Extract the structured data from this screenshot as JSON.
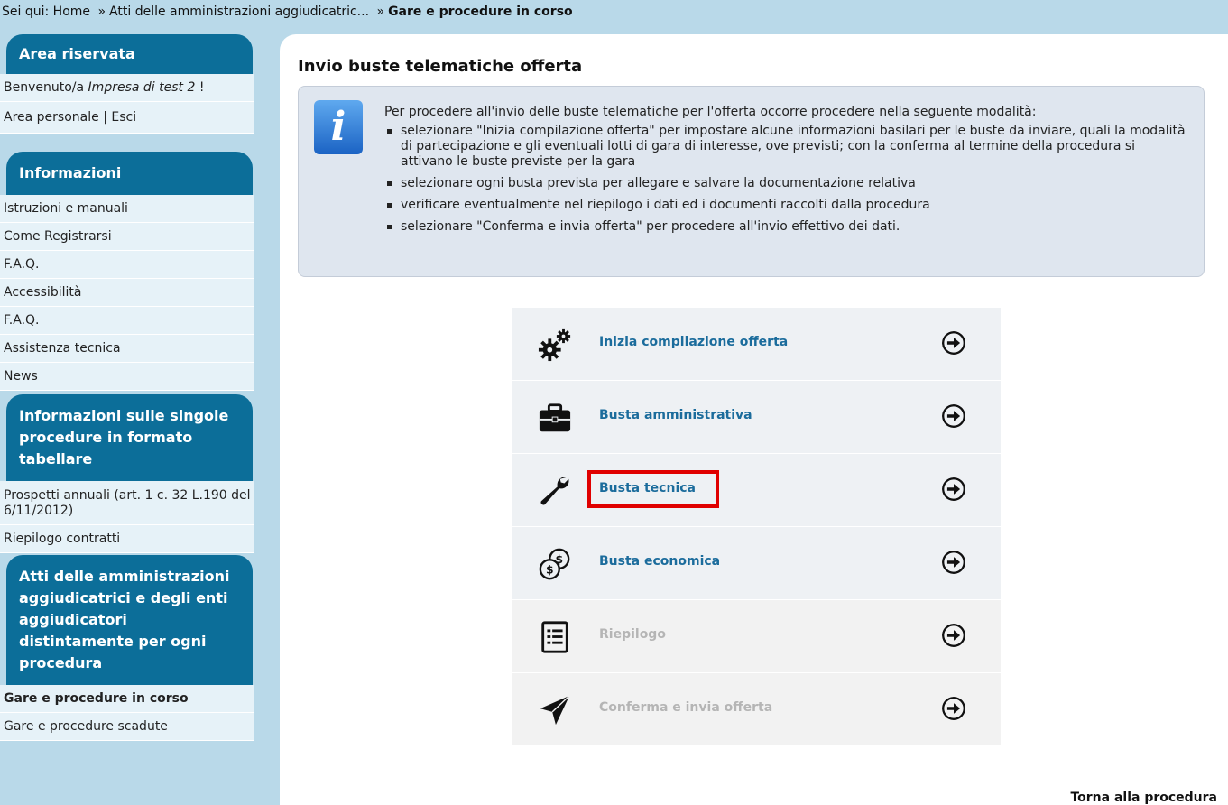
{
  "breadcrumb": {
    "prefix": "Sei qui:",
    "home": "Home",
    "sep1": "»",
    "atti": "Atti delle amministrazioni aggiudicatric...",
    "sep2": "»",
    "current": "Gare e procedure in corso"
  },
  "sidebar": {
    "area_riservata": {
      "title": "Area riservata",
      "welcome_prefix": "Benvenuto/a",
      "welcome_user": "Impresa di test 2",
      "welcome_suffix": "!",
      "area_personale": "Area personale",
      "separator": "|",
      "esci": "Esci"
    },
    "informazioni": {
      "title": "Informazioni",
      "items": [
        "Istruzioni e manuali",
        "Come Registrarsi",
        "F.A.Q.",
        "Accessibilità",
        "F.A.Q.",
        "Assistenza tecnica",
        "News"
      ]
    },
    "tabellari": {
      "title": "Informazioni sulle singole procedure in formato tabellare",
      "items": [
        "Prospetti annuali (art. 1 c. 32 L.190 del 6/11/2012)",
        "Riepilogo contratti"
      ]
    },
    "atti": {
      "title": "Atti delle amministrazioni aggiudicatrici e degli enti aggiudicatori distintamente per ogni procedura",
      "items": [
        "Gare e procedure in corso",
        "Gare e procedure scadute"
      ]
    }
  },
  "main": {
    "title": "Invio buste telematiche offerta",
    "info": {
      "icon": "info-icon",
      "intro": "Per procedere all'invio delle buste telematiche per l'offerta occorre procedere nella seguente modalità:",
      "steps": [
        "selezionare \"Inizia compilazione offerta\" per impostare alcune informazioni basilari per le buste da inviare, quali la modalità di partecipazione e gli eventuali lotti di gara di interesse, ove previsti; con la conferma al termine della procedura si attivano le buste previste per la gara",
        "selezionare ogni busta prevista per allegare e salvare la documentazione relativa",
        "verificare eventualmente nel riepilogo i dati ed i documenti raccolti dalla procedura",
        "selezionare \"Conferma e invia offerta\" per procedere all'invio effettivo dei dati."
      ]
    },
    "actions": [
      {
        "label": "Inizia compilazione offerta",
        "icon": "gears-icon",
        "enabled": true
      },
      {
        "label": "Busta amministrativa",
        "icon": "briefcase-icon",
        "enabled": true
      },
      {
        "label": "Busta tecnica",
        "icon": "wrench-icon",
        "enabled": true,
        "highlighted": true
      },
      {
        "label": "Busta economica",
        "icon": "money-icon",
        "enabled": true
      },
      {
        "label": "Riepilogo",
        "icon": "list-document-icon",
        "enabled": false
      },
      {
        "label": "Conferma e invia offerta",
        "icon": "paper-plane-icon",
        "enabled": false
      }
    ],
    "back_link": "Torna alla procedura"
  },
  "colors": {
    "page_bg": "#b9d9e9",
    "panel_header": "#0c6e99",
    "link": "#1b6c9c",
    "highlight": "#e00000",
    "disabled_text": "#b5b5b5"
  }
}
